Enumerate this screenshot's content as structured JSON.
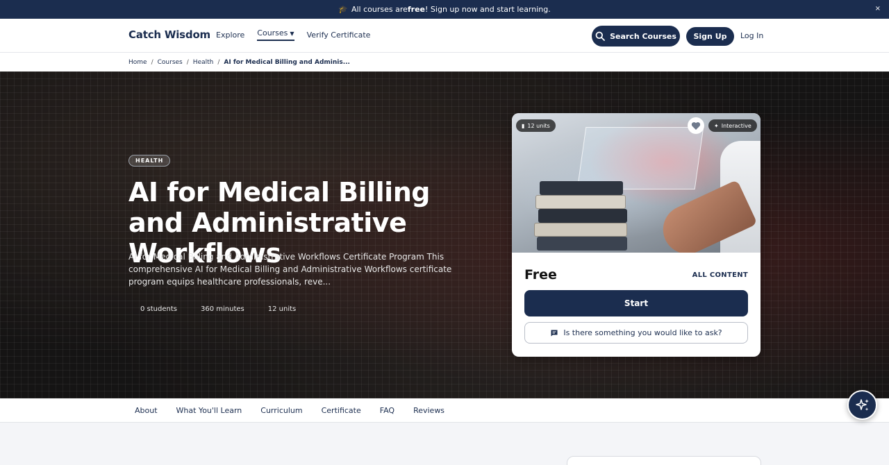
{
  "announcement": {
    "prefix": "All courses are ",
    "highlight": "free",
    "suffix": "! Sign up now and start learning.",
    "close_label": "×"
  },
  "header": {
    "logo": "Catch Wisdom",
    "nav": {
      "explore": "Explore",
      "courses": "Courses",
      "verify": "Verify Certificate"
    },
    "search_label": "Search Courses",
    "signup_label": "Sign Up",
    "login_label": "Log In"
  },
  "breadcrumb": {
    "home": "Home",
    "courses": "Courses",
    "category": "Health",
    "current": "AI for Medical Billing and Adminis..."
  },
  "hero": {
    "tag": "HEALTH",
    "title": "AI for Medical Billing and Administrative Workflows",
    "description": "AI for Medical Billing and Administrative Workflows Certificate Program This comprehensive AI for Medical Billing and Administrative Workflows certificate program equips healthcare professionals, reve...",
    "stats": {
      "students": "0 students",
      "minutes": "360 minutes",
      "units": "12 units"
    }
  },
  "card": {
    "units_badge": "12 units",
    "interactive_badge": "Interactive",
    "price": "Free",
    "access": "ALL CONTENT",
    "start_label": "Start",
    "ask_label": "Is there something you would like to ask?"
  },
  "tabs": [
    "About",
    "What You'll Learn",
    "Curriculum",
    "Certificate",
    "FAQ",
    "Reviews"
  ],
  "colors": {
    "primary": "#1b2d4f",
    "white": "#ffffff"
  }
}
